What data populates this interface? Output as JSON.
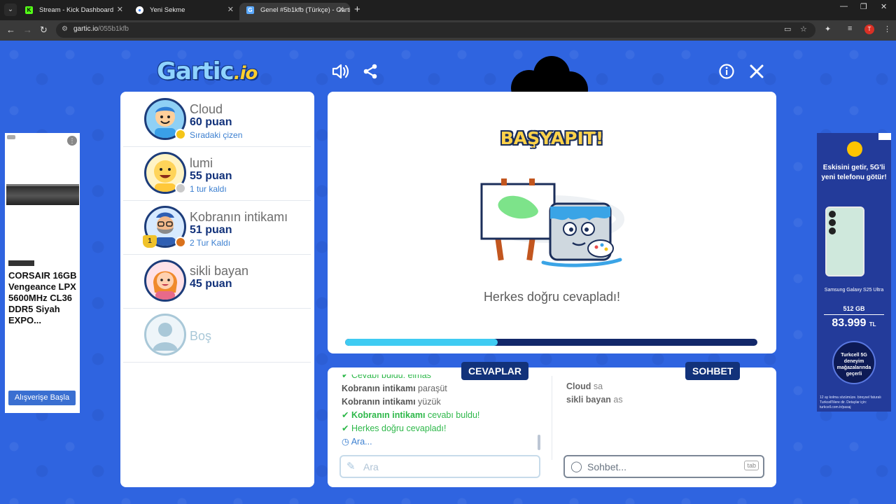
{
  "browser": {
    "tabs": [
      {
        "title": "Stream - Kick Dashboard",
        "favicon": "K"
      },
      {
        "title": "Yeni Sekme",
        "favicon": "chrome-icon"
      },
      {
        "title": "Genel #5b1kfb (Türkçe) - Gartic",
        "favicon": "G"
      }
    ],
    "url_host": "gartic.io",
    "url_path": "/055b1kfb",
    "profile_initial": "T"
  },
  "game": {
    "logo_main": "Gartic",
    "logo_suffix": ".io",
    "players": [
      {
        "name": "Cloud",
        "points": "60 puan",
        "note": "Sıradaki çizen",
        "dot": "#f5c518"
      },
      {
        "name": "lumi",
        "points": "55 puan",
        "note": "1 tur kaldı",
        "dot": "#c9c9c9"
      },
      {
        "name": "Kobranın intikamı",
        "points": "51 puan",
        "note": "2 Tur Kaldı",
        "dot": "#d9711c",
        "trophy": "1"
      },
      {
        "name": "sikli bayan",
        "points": "45 puan",
        "note": ""
      },
      {
        "name": "Boş",
        "points": "",
        "note": ""
      }
    ],
    "title": "BAŞYAPIT!",
    "status": "Herkes doğru cevapladı!",
    "progress": 0.37,
    "tabs": {
      "answers": "CEVAPLAR",
      "chat": "SOHBET"
    },
    "answers": [
      {
        "kind": "ok",
        "user": "",
        "text": "Cevabı buldu: elmas"
      },
      {
        "kind": "guess",
        "user": "Kobranın intikamı",
        "text": " paraşüt"
      },
      {
        "kind": "guess",
        "user": "Kobranın intikamı",
        "text": " yüzük"
      },
      {
        "kind": "ok",
        "user": "Kobranın intikamı",
        "text": " cevabı buldu!"
      },
      {
        "kind": "ok",
        "user": "",
        "text": "Herkes doğru cevapladı!"
      },
      {
        "kind": "info",
        "user": "",
        "text": "Ara..."
      }
    ],
    "chat": [
      {
        "user": "Cloud",
        "text": " sa"
      },
      {
        "user": "sikli bayan",
        "text": " as"
      }
    ],
    "answer_placeholder": "Ara",
    "chat_placeholder": "Sohbet...",
    "chat_key": "tab"
  },
  "ads": {
    "left": {
      "text": "CORSAIR 16GB Vengeance LPX 5600MHz CL36 DDR5 Siyah EXPO...",
      "button": "Alışverişe Başla"
    },
    "right": {
      "headline": "Eskisini getir, 5G'li yeni telefonu götür!",
      "model": "Samsung Galaxy S25 Ultra",
      "storage": "512 GB",
      "price": "83.999",
      "currency": "TL",
      "badge": "Turkcell 5G deneyim mağazalarında geçerli",
      "fine": "12 ay kolma sözümüze. bireysel faturalı Turkcell'lilere dir. Detaylar için: turkcell.com.tr/pasaj"
    }
  }
}
